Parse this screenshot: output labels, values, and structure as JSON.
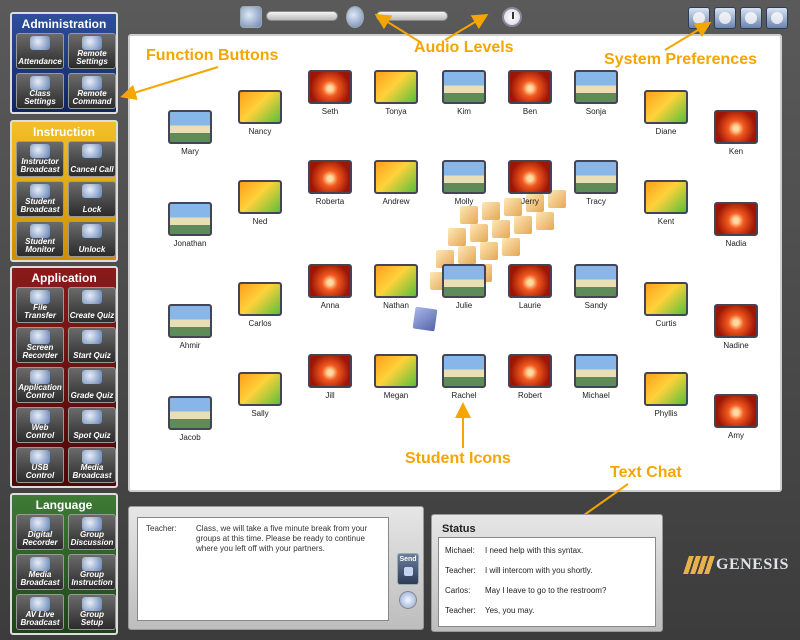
{
  "admin": {
    "title": "Administration",
    "buttons": [
      {
        "label": "Attendance",
        "icon": "attendance-icon"
      },
      {
        "label": "Remote Settings",
        "icon": "remote-settings-icon"
      },
      {
        "label": "Class Settings",
        "icon": "class-settings-icon"
      },
      {
        "label": "Remote Command",
        "icon": "remote-command-icon"
      }
    ]
  },
  "instruction": {
    "title": "Instruction",
    "buttons": [
      {
        "label": "Instructor Broadcast",
        "icon": "broadcast-icon"
      },
      {
        "label": "Cancel Call",
        "icon": "hand-icon"
      },
      {
        "label": "Student Broadcast",
        "icon": "broadcast-icon"
      },
      {
        "label": "Lock",
        "icon": "lock-icon"
      },
      {
        "label": "Student Monitor",
        "icon": "monitor-icon"
      },
      {
        "label": "Unlock",
        "icon": "unlock-icon"
      }
    ]
  },
  "application": {
    "title": "Application",
    "buttons": [
      {
        "label": "File Transfer",
        "icon": "file-transfer-icon"
      },
      {
        "label": "Create Quiz",
        "icon": "create-quiz-icon"
      },
      {
        "label": "Screen Recorder",
        "icon": "screen-recorder-icon"
      },
      {
        "label": "Start Quiz",
        "icon": "start-quiz-icon"
      },
      {
        "label": "Application Control",
        "icon": "application-control-icon"
      },
      {
        "label": "Grade Quiz",
        "icon": "grade-quiz-icon"
      },
      {
        "label": "Web Control",
        "icon": "web-control-icon"
      },
      {
        "label": "Spot Quiz",
        "icon": "spot-quiz-icon"
      },
      {
        "label": "USB Control",
        "icon": "usb-icon"
      },
      {
        "label": "Media Broadcast",
        "icon": "media-broadcast-icon"
      }
    ]
  },
  "language": {
    "title": "Language",
    "buttons": [
      {
        "label": "Digital Recorder",
        "icon": "recorder-icon"
      },
      {
        "label": "Group Discussion",
        "icon": "group-discussion-icon"
      },
      {
        "label": "Media Broadcast",
        "icon": "media-broadcast-icon"
      },
      {
        "label": "Group Instruction",
        "icon": "group-instruction-icon"
      },
      {
        "label": "AV Live Broadcast",
        "icon": "av-live-icon"
      },
      {
        "label": "Group Setup",
        "icon": "gear-icon"
      }
    ]
  },
  "annotations": {
    "function_buttons": "Function Buttons",
    "audio_levels": "Audio Levels",
    "system_preferences": "System Preferences",
    "student_icons": "Student Icons",
    "text_chat": "Text Chat"
  },
  "students": [
    {
      "name": "Mary",
      "img": "beach"
    },
    {
      "name": "Nancy",
      "img": "sunset"
    },
    {
      "name": "Seth",
      "img": "red"
    },
    {
      "name": "Tonya",
      "img": "sunset"
    },
    {
      "name": "Kim",
      "img": "beach"
    },
    {
      "name": "Ben",
      "img": "red"
    },
    {
      "name": "Sonja",
      "img": "beach"
    },
    {
      "name": "Diane",
      "img": "sunset"
    },
    {
      "name": "Ken",
      "img": "red"
    },
    {
      "name": "Roberta",
      "img": "red"
    },
    {
      "name": "Andrew",
      "img": "sunset"
    },
    {
      "name": "Molly",
      "img": "beach"
    },
    {
      "name": "Jerry",
      "img": "red"
    },
    {
      "name": "Tracy",
      "img": "beach"
    },
    {
      "name": "Ned",
      "img": "sunset"
    },
    {
      "name": "Kent",
      "img": "sunset"
    },
    {
      "name": "Jonathan",
      "img": "beach"
    },
    {
      "name": "Nadia",
      "img": "red"
    },
    {
      "name": "Anna",
      "img": "red"
    },
    {
      "name": "Nathan",
      "img": "sunset"
    },
    {
      "name": "Julie",
      "img": "beach"
    },
    {
      "name": "Laurie",
      "img": "red"
    },
    {
      "name": "Sandy",
      "img": "beach"
    },
    {
      "name": "Carlos",
      "img": "sunset"
    },
    {
      "name": "Curtis",
      "img": "sunset"
    },
    {
      "name": "Ahmir",
      "img": "beach"
    },
    {
      "name": "Nadine",
      "img": "red"
    },
    {
      "name": "Jill",
      "img": "red"
    },
    {
      "name": "Megan",
      "img": "sunset"
    },
    {
      "name": "Rachel",
      "img": "beach"
    },
    {
      "name": "Robert",
      "img": "red"
    },
    {
      "name": "Michael",
      "img": "beach"
    },
    {
      "name": "Sally",
      "img": "sunset"
    },
    {
      "name": "Phyllis",
      "img": "sunset"
    },
    {
      "name": "Jacob",
      "img": "beach"
    },
    {
      "name": "Amy",
      "img": "red"
    }
  ],
  "message": {
    "sender": "Teacher:",
    "text": "Class, we will take a five minute break from your groups at this time.  Please be ready to continue where you left off with your partners.",
    "send_label": "Send"
  },
  "status": {
    "title": "Status",
    "rows": [
      {
        "who": "Michael:",
        "text": "I need help with this syntax."
      },
      {
        "who": "Teacher:",
        "text": "I will intercom with you shortly."
      },
      {
        "who": "Carlos:",
        "text": "May I leave to go to the restroom?"
      },
      {
        "who": "Teacher:",
        "text": "Yes, you may."
      }
    ]
  },
  "brand": "GENESIS",
  "colors": {
    "annotation": "#f5a500",
    "admin": "#1f3a80",
    "instruction": "#e0a400",
    "application": "#6a0f0f",
    "language": "#2c5c24"
  }
}
